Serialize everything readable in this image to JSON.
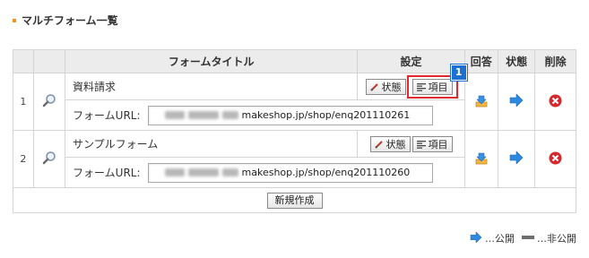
{
  "page_title": "マルチフォーム一覧",
  "table": {
    "headers": {
      "title": "フォームタイトル",
      "settings": "設定",
      "answers": "回答",
      "status": "状態",
      "delete": "削除"
    },
    "rows": [
      {
        "number": "1",
        "name": "資料請求",
        "url_label": "フォームURL:",
        "url_visible": "makeshop.jp/shop/enq201110261",
        "status_button": "状態",
        "items_button": "項目",
        "highlighted": true,
        "badge": "1"
      },
      {
        "number": "2",
        "name": "サンプルフォーム",
        "url_label": "フォームURL:",
        "url_visible": "makeshop.jp/shop/enq201110260",
        "status_button": "状態",
        "items_button": "項目",
        "highlighted": false
      }
    ],
    "new_button": "新規作成"
  },
  "legend": {
    "public": "…公開",
    "private": "…非公開"
  },
  "colors": {
    "accent": "#f7941d",
    "highlight": "#e0282f",
    "badge": "#1e6fd0",
    "arrow": "#2a8be0",
    "delete": "#d9262c"
  }
}
